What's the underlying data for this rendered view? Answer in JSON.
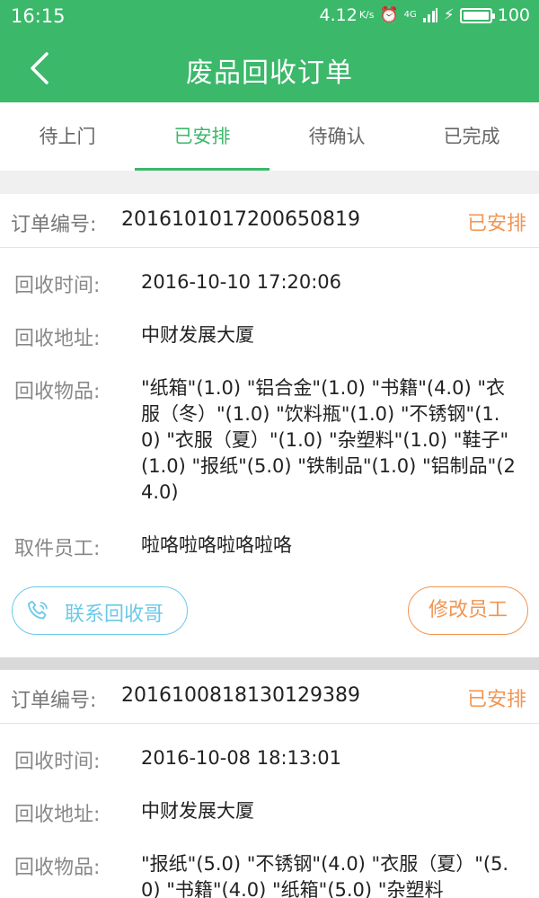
{
  "status_bar": {
    "time": "16:15",
    "speed": "4.12",
    "speed_unit": "K/s",
    "network": "4G",
    "battery": "100"
  },
  "header": {
    "title": "废品回收订单",
    "back_icon": "back-arrow-icon"
  },
  "tabs": [
    {
      "label": "待上门"
    },
    {
      "label": "已安排"
    },
    {
      "label": "待确认"
    },
    {
      "label": "已完成"
    }
  ],
  "active_tab": "已安排",
  "field_labels": {
    "order_no": "订单编号:",
    "time": "回收时间:",
    "address": "回收地址:",
    "items": "回收物品:",
    "staff": "取件员工:"
  },
  "orders": [
    {
      "order_no": "2016101017200650819",
      "status": "已安排",
      "time": "2016-10-10 17:20:06",
      "address": "中财发展大厦",
      "items": "\"纸箱\"(1.0) \"铝合金\"(1.0) \"书籍\"(4.0) \"衣服（冬）\"(1.0) \"饮料瓶\"(1.0) \"不锈钢\"(1.0) \"衣服（夏）\"(1.0) \"杂塑料\"(1.0) \"鞋子\"(1.0) \"报纸\"(5.0) \"铁制品\"(1.0) \"铝制品\"(24.0)",
      "staff": "啦咯啦咯啦咯啦咯",
      "contact_button": "联系回收哥",
      "edit_button": "修改员工"
    },
    {
      "order_no": "2016100818130129389",
      "status": "已安排",
      "time": "2016-10-08 18:13:01",
      "address": "中财发展大厦",
      "items": "\"报纸\"(5.0) \"不锈钢\"(4.0) \"衣服（夏）\"(5.0) \"书籍\"(4.0) \"纸箱\"(5.0) \"杂塑料"
    }
  ],
  "colors": {
    "primary_green": "#3bb86a",
    "status_orange": "#f29552",
    "contact_blue": "#6cc9e8"
  }
}
